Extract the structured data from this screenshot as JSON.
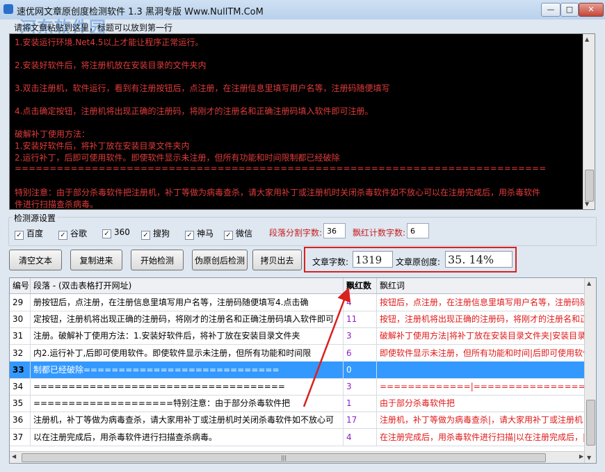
{
  "window": {
    "title": "速优网文章原创度检测软件 1.3   黑洞专版 Www.NullTM.CoM",
    "watermark": "河东软件园",
    "minimize_glyph": "—",
    "maximize_glyph": "□",
    "close_glyph": "✕"
  },
  "tip": "请将文章粘贴到这里，标题可以放到第一行",
  "console_lines": [
    {
      "text": "1.安装运行环境.Net4.5以上才能让程序正常运行。",
      "color": "red"
    },
    {
      "text": "2.安装好软件后，将注册机放在安装目录的文件夹内",
      "color": "red"
    },
    {
      "text": "3.双击注册机，软件运行，看到有注册按钮后，点注册，在注册信息里填写用户名等，注册码随便填写",
      "color": "red"
    },
    {
      "text": "4.点击确定按钮，注册机将出现正确的注册码，将刚才的注册名和正确注册码填入软件即可注册。",
      "color": "red"
    },
    {
      "text": "破解补丁使用方法：",
      "color": "red"
    },
    {
      "text": "1.安装好软件后，将补丁放在安装目录文件夹内",
      "color": "red"
    },
    {
      "text": "2.运行补丁，后即可使用软件。即使软件显示未注册，但所有功能和时间限制都已经破除",
      "color": "red"
    },
    {
      "text": "============================================================================",
      "color": "red"
    },
    {
      "text": "特别注意：由于部分杀毒软件把注册机，补丁等做为病毒查杀，请大家用补丁或注册机时关闭杀毒软件如不放心可以在注册完成后，用杀毒软件",
      "color": "red"
    },
    {
      "text": "件进行扫描查杀病毒。",
      "color": "red"
    }
  ],
  "sources": {
    "label": "检测源设置",
    "items": [
      {
        "label": "百度",
        "checked": true
      },
      {
        "label": "谷歌",
        "checked": true
      },
      {
        "label": "360",
        "checked": true
      },
      {
        "label": "搜狗",
        "checked": true
      },
      {
        "label": "神马",
        "checked": true
      },
      {
        "label": "微信",
        "checked": true
      }
    ],
    "segment_label": "段落分割字数:",
    "segment_value": "36",
    "red_label": "飘红计数字数:",
    "red_value": "6"
  },
  "buttons": {
    "clear": "清空文本",
    "paste": "复制进来",
    "start": "开始检测",
    "fake": "伪原创后检测",
    "copy_out": "拷贝出去"
  },
  "stats": {
    "word_count_label": "文章字数:",
    "word_count_value": "1319",
    "originality_label": "文章原创度:",
    "originality_value": "35. 14%"
  },
  "table": {
    "headers": [
      "编号",
      "段落 - (双击表格打开网址)",
      "飘红数",
      "飘红词"
    ],
    "rows": [
      {
        "id": "29",
        "para": "册按钮后，点注册，在注册信息里填写用户名等，注册码随便填写4.点击确",
        "count": "4",
        "words": "按钮后，点注册，在注册信息里填写用户名等，注册码随",
        "selected": false
      },
      {
        "id": "30",
        "para": "定按钮，注册机将出现正确的注册码，将刚才的注册名和正确注册码填入软件即可",
        "count": "11",
        "words": "按钮，注册机将出现正确的注册码，将刚才的注册名和正",
        "selected": false
      },
      {
        "id": "31",
        "para": "注册。破解补丁使用方法：1.安装好软件后，将补丁放在安装目录文件夹",
        "count": "3",
        "words": "破解补丁使用方法|将补丁放在安装目录文件夹|安装目录",
        "selected": false
      },
      {
        "id": "32",
        "para": "内2.运行补丁,后即可使用软件。即使软件显示未注册，但所有功能和时间限",
        "count": "6",
        "words": "即使软件显示未注册，但所有功能和时间|后即可使用软件",
        "selected": false
      },
      {
        "id": "33",
        "para": "制都已经破除============================",
        "count": "0",
        "words": "",
        "selected": true
      },
      {
        "id": "34",
        "para": "====================================",
        "count": "3",
        "words": "=============|=================|=",
        "selected": false
      },
      {
        "id": "35",
        "para": "====================特别注意：由于部分杀毒软件把",
        "count": "1",
        "words": "由于部分杀毒软件把",
        "selected": false
      },
      {
        "id": "36",
        "para": "注册机，补丁等做为病毒查杀，请大家用补丁或注册机时关闭杀毒软件如不放心可",
        "count": "17",
        "words": "注册机，补丁等做为病毒查杀|，请大家用补丁或注册机",
        "selected": false
      },
      {
        "id": "37",
        "para": "以在注册完成后，用杀毒软件进行扫描查杀病毒。",
        "count": "4",
        "words": "在注册完成后，用杀毒软件进行扫描|以在注册完成后，|",
        "selected": false
      }
    ],
    "scroll_grip": "|||"
  },
  "colors": {
    "console_red": "#e23b3b",
    "highlight_box": "#d9211e",
    "selected_row": "#3399ff",
    "count_purple": "#8b1ec8",
    "redword": "#e01818"
  }
}
